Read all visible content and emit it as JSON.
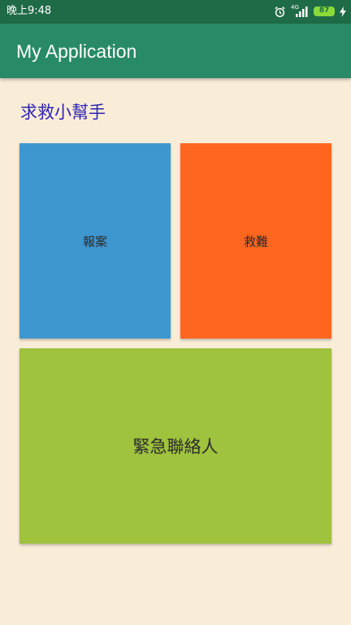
{
  "status_bar": {
    "time": "晚上9:48",
    "network": "4G",
    "battery": "87",
    "icons": [
      "alarm-icon",
      "signal-icon",
      "battery-icon",
      "charging-icon"
    ]
  },
  "app_bar": {
    "title": "My Application"
  },
  "main": {
    "heading": "求救小幫手",
    "tiles": [
      {
        "label": "報案",
        "color": "#3F97D0"
      },
      {
        "label": "救難",
        "color": "#FF6720"
      },
      {
        "label": "緊急聯絡人",
        "color": "#9FC23F"
      }
    ]
  },
  "colors": {
    "status_bar": "#1F6B47",
    "app_bar": "#288A66",
    "background": "#FAEDD7",
    "heading": "#2E23B8"
  }
}
